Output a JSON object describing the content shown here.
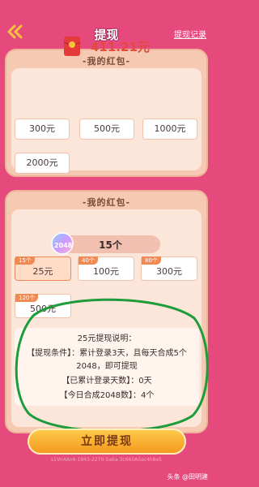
{
  "header": {
    "title": "提现",
    "records_link": "提现记录",
    "back_icon": "double-chevron-left-icon"
  },
  "card1": {
    "title": "-我的红包-",
    "balance": "411.21元",
    "amounts": [
      "300元",
      "500元",
      "1000元",
      "2000元"
    ]
  },
  "card2": {
    "title": "-我的红包-",
    "coin_label": "2048",
    "coin_count": "15个",
    "tiers": [
      {
        "badge": "15个",
        "value": "25元",
        "selected": true
      },
      {
        "badge": "40个",
        "value": "100元",
        "selected": false
      },
      {
        "badge": "80个",
        "value": "300元",
        "selected": false
      },
      {
        "badge": "120个",
        "value": "500元",
        "selected": false
      }
    ],
    "explanation": {
      "heading": "25元提现说明：",
      "condition_line1": "【提现条件】：累计登录3天，且每天合成5个",
      "condition_line2": "2048，即可提现",
      "login_days": "【已累计登录天数】：0天",
      "today_merge": "【今日合成2048数】：4个"
    }
  },
  "withdraw_button": "立即提现",
  "footer_code": "s1Vn4An6-1943-2270-5a6a-3c660A0ac4h8e5",
  "watermark": "头条 @田明建",
  "colors": {
    "background": "#e64a7c",
    "card": "#f6c9b2",
    "accent": "#f08a55",
    "balance": "#e14a3c",
    "highlight_circle": "#1e9b3a"
  }
}
